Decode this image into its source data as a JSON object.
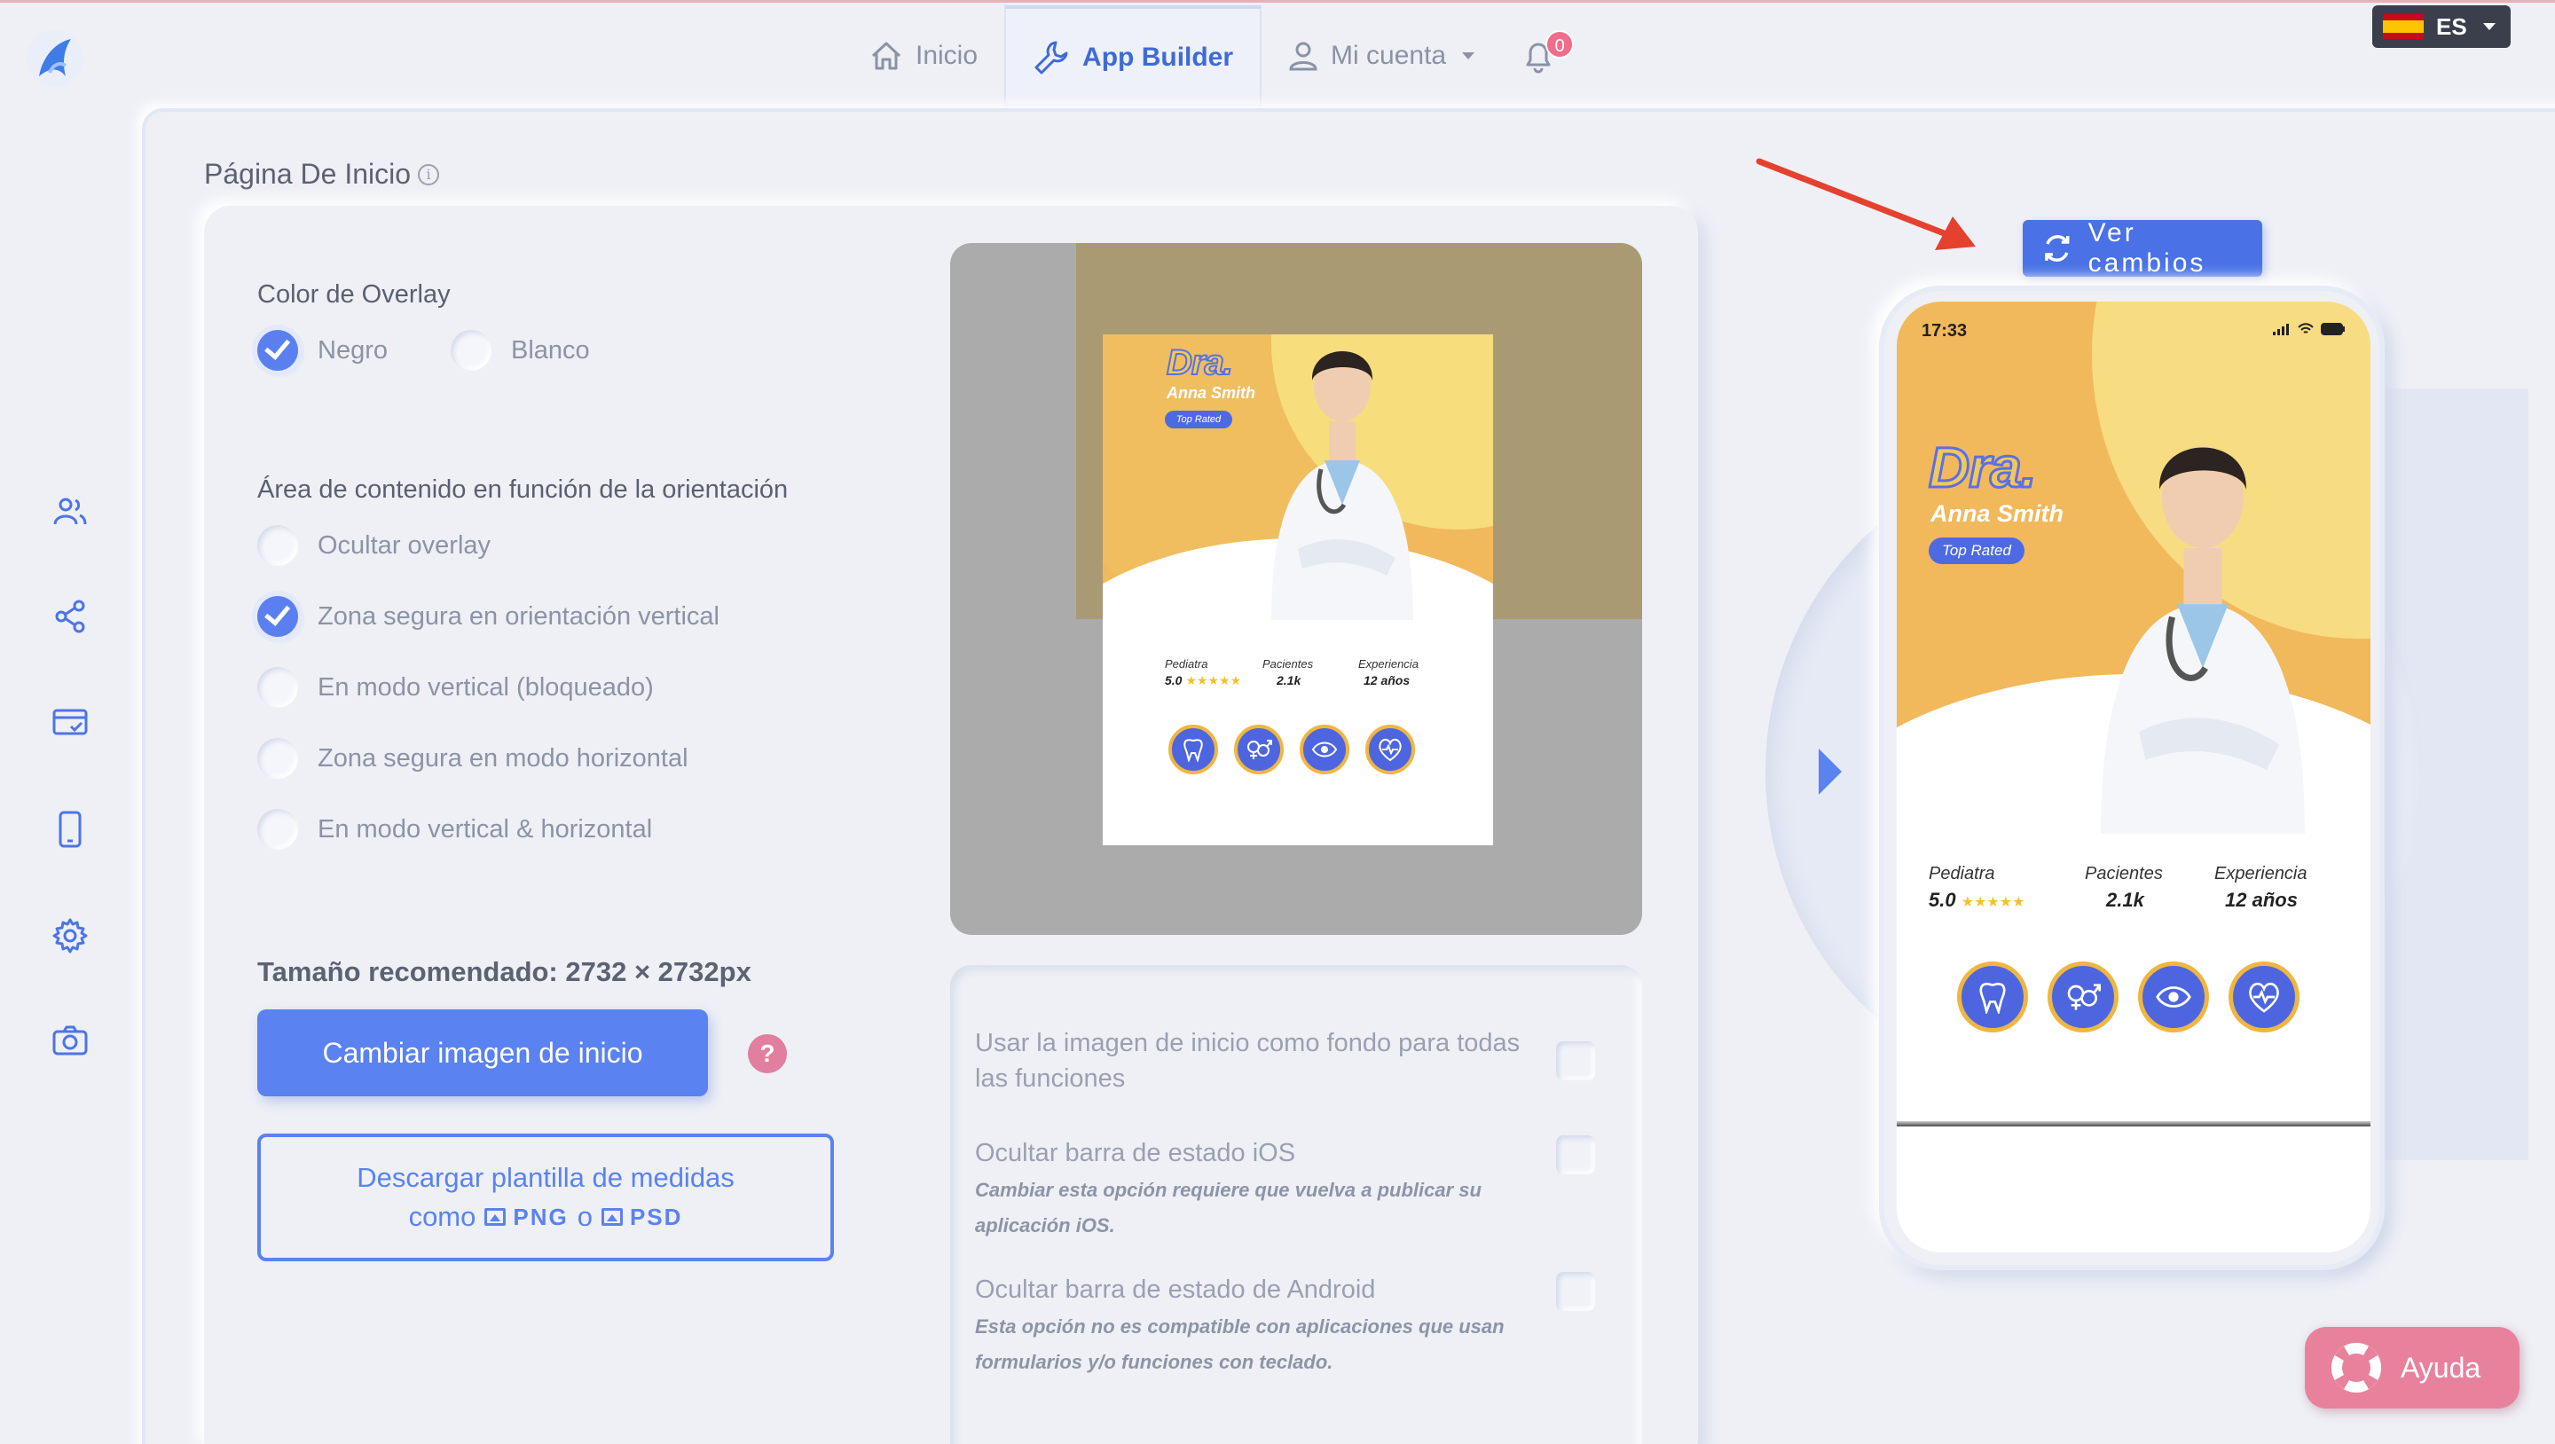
{
  "nav": {
    "items": [
      {
        "label": "Inicio",
        "icon": "home-icon"
      },
      {
        "label": "App Builder",
        "icon": "wrench-icon"
      },
      {
        "label": "Mi cuenta",
        "icon": "user-icon"
      }
    ],
    "notifications": "0"
  },
  "language": {
    "code": "ES"
  },
  "sidebar": {
    "icons": [
      "users-icon",
      "share-icon",
      "payment-card-icon",
      "mobile-icon",
      "gear-icon",
      "camera-icon"
    ]
  },
  "page": {
    "title": "Página De Inicio"
  },
  "overlay": {
    "label": "Color de Overlay",
    "options": [
      {
        "label": "Negro",
        "selected": true
      },
      {
        "label": "Blanco",
        "selected": false
      }
    ]
  },
  "orientation": {
    "label": "Área de contenido en función de la orientación",
    "options": [
      {
        "label": "Ocultar overlay",
        "selected": false
      },
      {
        "label": "Zona segura en orientación vertical",
        "selected": true
      },
      {
        "label": "En modo vertical (bloqueado)",
        "selected": false
      },
      {
        "label": "Zona segura en modo horizontal",
        "selected": false
      },
      {
        "label": "En modo vertical & horizontal",
        "selected": false
      }
    ]
  },
  "image": {
    "recommended": "Tamaño recomendado: 2732 × 2732px",
    "change_button": "Cambiar imagen de inicio",
    "help": "?",
    "download_line1": "Descargar plantilla de medidas",
    "download_como": "como",
    "download_png": "PNG",
    "download_o": "o",
    "download_psd": "PSD"
  },
  "options": [
    {
      "text": "Usar la imagen de inicio como fondo para todas las funciones",
      "note": ""
    },
    {
      "text": "Ocultar barra de estado iOS",
      "note": "Cambiar esta opción requiere que vuelva a publicar su aplicación iOS."
    },
    {
      "text": "Ocultar barra de estado de Android",
      "note": "Esta opción no es compatible con aplicaciones que usan formularios y/o funciones con teclado."
    }
  ],
  "preview": {
    "dra": "Dra.",
    "name": "Anna Smith",
    "badge": "Top Rated",
    "stats": [
      {
        "label": "Pediatra",
        "value": "5.0",
        "stars": "★★★★★"
      },
      {
        "label": "Pacientes",
        "value": "2.1k",
        "stars": ""
      },
      {
        "label": "Experiencia",
        "value": "12 años",
        "stars": ""
      }
    ],
    "services": [
      "tooth-icon",
      "gender-icon",
      "eye-icon",
      "heart-pulse-icon"
    ]
  },
  "phone": {
    "time": "17:33"
  },
  "actions": {
    "ver_cambios": "Ver cambios",
    "ayuda": "Ayuda"
  },
  "colors": {
    "accent": "#5a82f0",
    "help": "#e8829c",
    "yellow": "#f0b84a",
    "blue": "#4d66e0"
  }
}
